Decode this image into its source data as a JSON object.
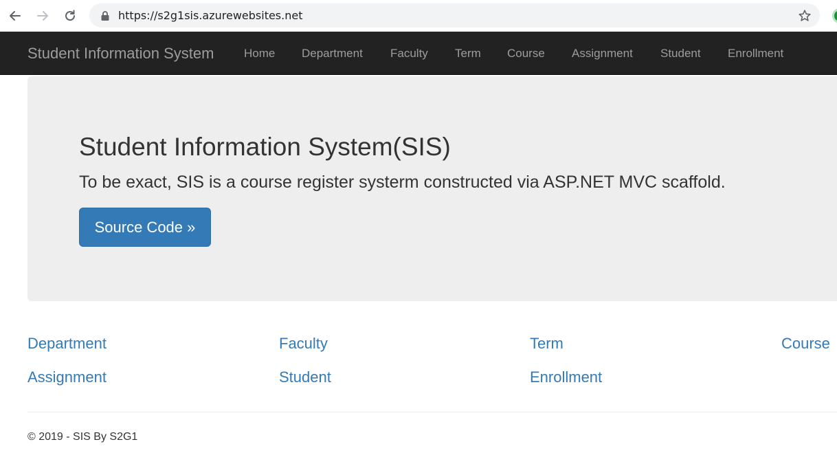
{
  "browser": {
    "url": "https://s2g1sis.azurewebsites.net",
    "back_icon": "arrow-left-icon",
    "forward_icon": "arrow-right-icon",
    "reload_icon": "reload-icon",
    "secure_icon": "lock-icon",
    "bookmark_icon": "star-icon"
  },
  "navbar": {
    "brand": "Student Information System",
    "links": [
      {
        "label": "Home"
      },
      {
        "label": "Department"
      },
      {
        "label": "Faculty"
      },
      {
        "label": "Term"
      },
      {
        "label": "Course"
      },
      {
        "label": "Assignment"
      },
      {
        "label": "Student"
      },
      {
        "label": "Enrollment"
      }
    ]
  },
  "jumbotron": {
    "title": "Student Information System(SIS)",
    "lead": "To be exact, SIS is a course register systerm constructed via ASP.NET MVC scaffold.",
    "button_label": "Source Code »"
  },
  "link_grid": [
    {
      "label": "Department"
    },
    {
      "label": "Faculty"
    },
    {
      "label": "Term"
    },
    {
      "label": "Course"
    },
    {
      "label": "Assignment"
    },
    {
      "label": "Student"
    },
    {
      "label": "Enrollment"
    }
  ],
  "footer": {
    "text": "© 2019 - SIS By S2G1"
  },
  "colors": {
    "navbar_bg": "#222222",
    "navbar_text": "#9d9d9d",
    "jumbotron_bg": "#eeeeee",
    "primary": "#337ab7",
    "link": "#337ab7",
    "text": "#333333"
  }
}
